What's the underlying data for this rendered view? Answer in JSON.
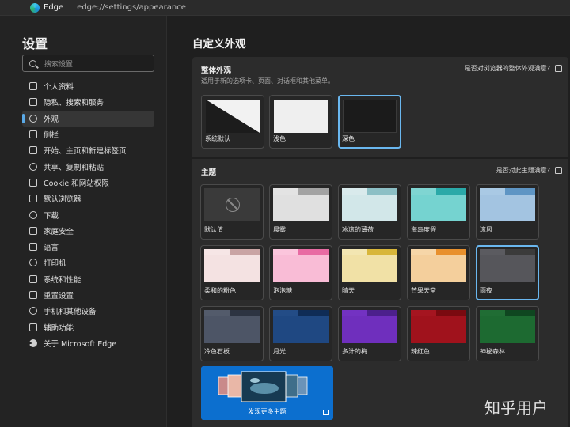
{
  "titlebar": {
    "app": "Edge",
    "url": "edge://settings/appearance"
  },
  "sidebar": {
    "title": "设置",
    "search_placeholder": "搜索设置",
    "items": [
      {
        "label": "个人资料",
        "icon": "profile-icon"
      },
      {
        "label": "隐私、搜索和服务",
        "icon": "lock-icon"
      },
      {
        "label": "外观",
        "icon": "appearance-icon",
        "active": true
      },
      {
        "label": "侧栏",
        "icon": "sidebar-icon"
      },
      {
        "label": "开始、主页和新建标签页",
        "icon": "home-icon"
      },
      {
        "label": "共享、复制和粘贴",
        "icon": "share-icon"
      },
      {
        "label": "Cookie 和网站权限",
        "icon": "cookie-icon"
      },
      {
        "label": "默认浏览器",
        "icon": "browser-icon"
      },
      {
        "label": "下载",
        "icon": "download-icon"
      },
      {
        "label": "家庭安全",
        "icon": "family-icon"
      },
      {
        "label": "语言",
        "icon": "language-icon"
      },
      {
        "label": "打印机",
        "icon": "printer-icon"
      },
      {
        "label": "系统和性能",
        "icon": "system-icon"
      },
      {
        "label": "重置设置",
        "icon": "reset-icon"
      },
      {
        "label": "手机和其他设备",
        "icon": "phone-icon"
      },
      {
        "label": "辅助功能",
        "icon": "accessibility-icon"
      },
      {
        "label": "关于 Microsoft Edge",
        "icon": "edge-icon"
      }
    ]
  },
  "main": {
    "title": "自定义外观",
    "overall": {
      "heading": "整体外观",
      "subtitle": "适用于新的选项卡、页面、对话框和其他菜单。",
      "feedback": "是否对浏览器的整体外观满意?",
      "options": [
        {
          "label": "系统默认",
          "selected": false
        },
        {
          "label": "浅色",
          "selected": false
        },
        {
          "label": "深色",
          "selected": true
        }
      ]
    },
    "theme": {
      "heading": "主题",
      "feedback": "是否对此主题满意?",
      "tiles": [
        {
          "label": "默认值",
          "none": true,
          "selected": false
        },
        {
          "label": "晨雾",
          "top": "#a3a3a3",
          "tab": "#e3e3e3",
          "body": "#e0e0e0",
          "selected": false
        },
        {
          "label": "冰凉的薄荷",
          "top": "#8cbfc5",
          "tab": "#d9eaec",
          "body": "#d2e7e9",
          "selected": false
        },
        {
          "label": "海岛度假",
          "top": "#2aa9a8",
          "tab": "#7fd5d2",
          "body": "#75d3d0",
          "selected": false
        },
        {
          "label": "凉风",
          "top": "#5e95c4",
          "tab": "#a9c9e4",
          "body": "#a3c4e1",
          "selected": false
        },
        {
          "label": "柔和的粉色",
          "top": "#c9a4a4",
          "tab": "#f6e6e6",
          "body": "#f4e2e2",
          "selected": false
        },
        {
          "label": "泡泡糖",
          "top": "#e86ba3",
          "tab": "#fbc5dc",
          "body": "#f9bcd6",
          "selected": false
        },
        {
          "label": "晴天",
          "top": "#d8b63a",
          "tab": "#f3e6b2",
          "body": "#f1e1a6",
          "selected": false
        },
        {
          "label": "芒果天堂",
          "top": "#e8902d",
          "tab": "#f6d6a8",
          "body": "#f4cf9c",
          "selected": false
        },
        {
          "label": "雨夜",
          "top": "#3b3b3b",
          "tab": "#5b5b60",
          "body": "#56565b",
          "selected": true
        },
        {
          "label": "冷色石板",
          "top": "#2d3442",
          "tab": "#535b6b",
          "body": "#4d5566",
          "selected": false
        },
        {
          "label": "月光",
          "top": "#0f2c56",
          "tab": "#234c86",
          "body": "#1f4882",
          "selected": false
        },
        {
          "label": "多汁的梅",
          "top": "#4c208c",
          "tab": "#7332c2",
          "body": "#6f2fbd",
          "selected": false
        },
        {
          "label": "辣红色",
          "top": "#7a0a10",
          "tab": "#a51520",
          "body": "#a0121c",
          "selected": false
        },
        {
          "label": "神秘森林",
          "top": "#0f4620",
          "tab": "#206d34",
          "body": "#1d6a31",
          "selected": false
        }
      ],
      "discover": "发现更多主题"
    }
  },
  "watermark": "知乎用户"
}
